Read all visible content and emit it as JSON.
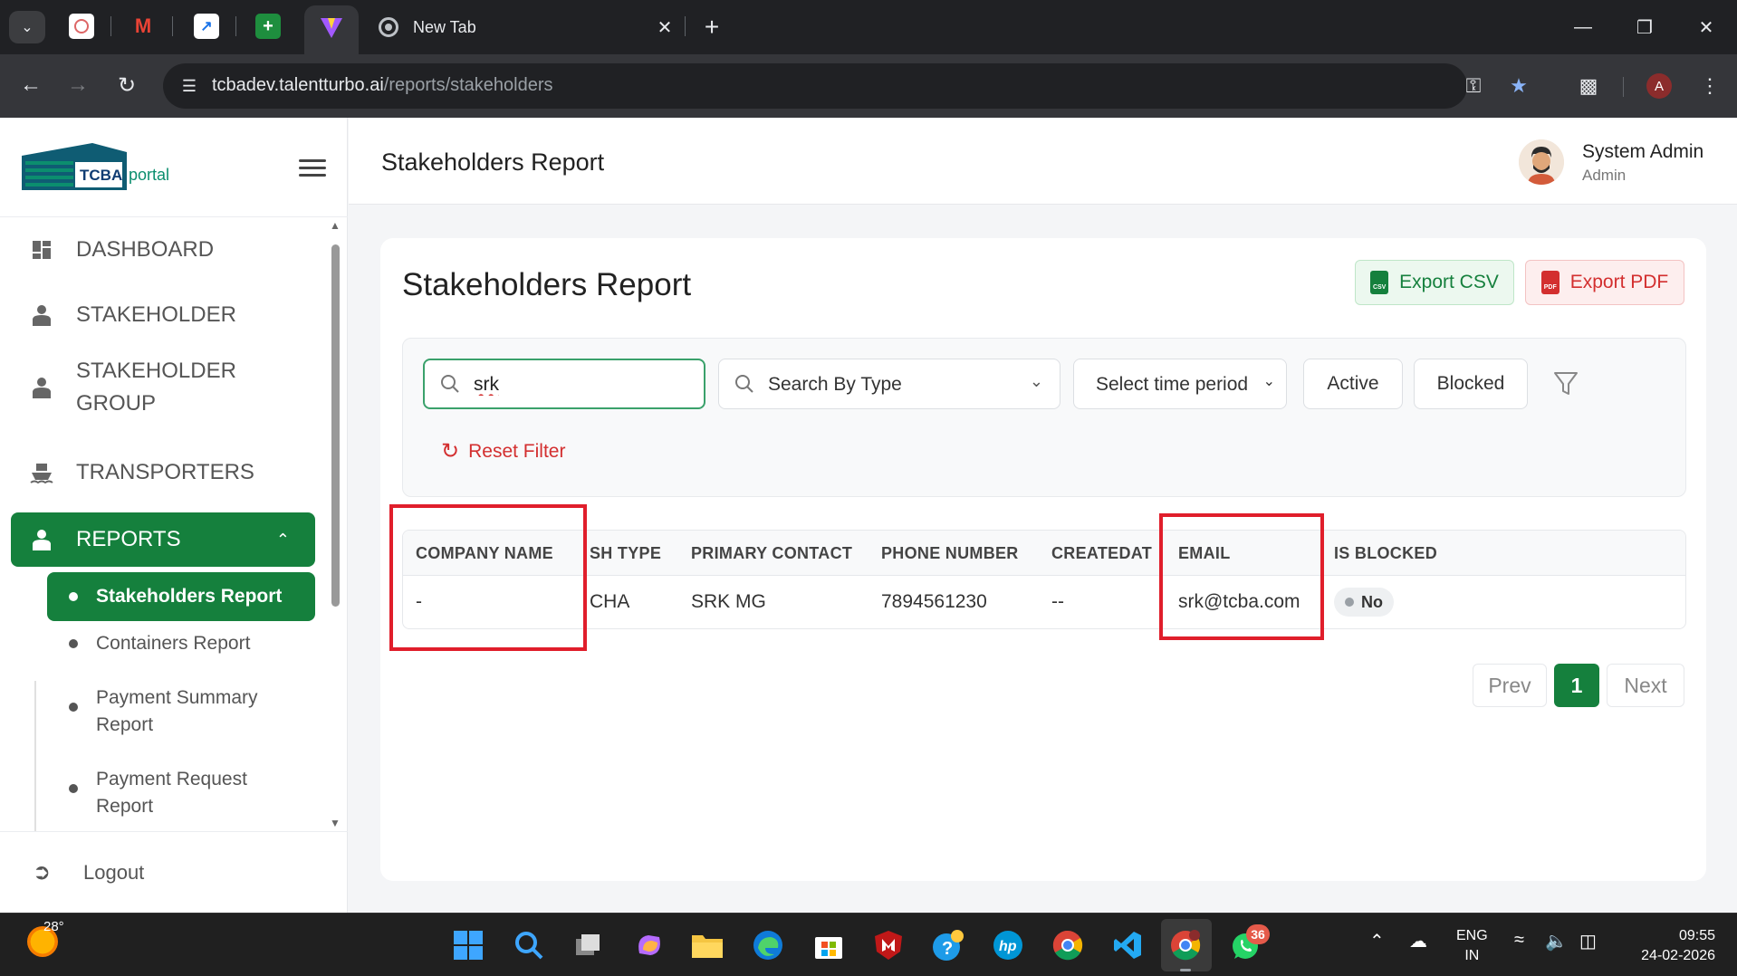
{
  "browser": {
    "active_tab_title": "New Tab",
    "url_host": "tcbadev.talentturbo.ai",
    "url_path": "/reports/stakeholders",
    "profile_initial": "A"
  },
  "sidebar": {
    "brand_text": "TCBA",
    "brand_sub": "portal",
    "items": [
      {
        "label": "DASHBOARD",
        "icon": "dashboard-icon"
      },
      {
        "label": "STAKEHOLDER",
        "icon": "person-icon"
      },
      {
        "label_line1": "STAKEHOLDER",
        "label_line2": "GROUP",
        "icon": "person-icon"
      },
      {
        "label": "TRANSPORTERS",
        "icon": "ship-icon"
      },
      {
        "label": "REPORTS",
        "icon": "person-icon"
      }
    ],
    "subitems": [
      {
        "label": "Stakeholders Report"
      },
      {
        "label": "Containers Report"
      },
      {
        "label_line1": "Payment Summary",
        "label_line2": "Report"
      },
      {
        "label_line1": "Payment Request",
        "label_line2": "Report"
      }
    ],
    "logout_label": "Logout"
  },
  "header": {
    "title": "Stakeholders Report",
    "user_name": "System Admin",
    "user_role": "Admin"
  },
  "card": {
    "title": "Stakeholders Report",
    "export_csv_label": "Export CSV",
    "export_pdf_label": "Export PDF"
  },
  "filters": {
    "search_value": "srk",
    "type_placeholder": "Search By Type",
    "time_period_label": "Select time period",
    "active_label": "Active",
    "blocked_label": "Blocked",
    "reset_label": "Reset Filter"
  },
  "table": {
    "columns": [
      "COMPANY NAME",
      "SH TYPE",
      "PRIMARY CONTACT",
      "PHONE NUMBER",
      "CREATEDAT",
      "EMAIL",
      "IS BLOCKED"
    ],
    "rows": [
      {
        "company_name": "-",
        "sh_type": "CHA",
        "primary_contact": "SRK MG",
        "phone_number": "7894561230",
        "created_at": "--",
        "email": "srk@tcba.com",
        "is_blocked": "No"
      }
    ]
  },
  "pagination": {
    "prev_label": "Prev",
    "current_page": "1",
    "next_label": "Next"
  },
  "taskbar": {
    "temperature": "28°",
    "whatsapp_badge": "36",
    "lang_line1": "ENG",
    "lang_line2": "IN",
    "time": "09:55",
    "date": "24-02-2026"
  },
  "colors": {
    "primary_green": "#15803d",
    "danger_red": "#d32f2f",
    "annotation_red": "#e01e2b"
  }
}
